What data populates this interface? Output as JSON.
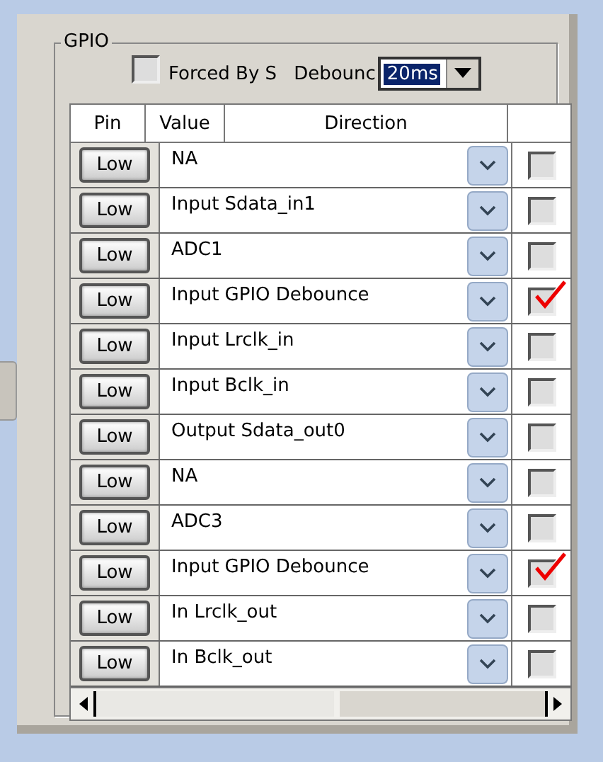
{
  "group": {
    "title": "GPIO"
  },
  "forced": {
    "label": "Forced By S",
    "checked": false
  },
  "debounce": {
    "label": "Debounc",
    "value": "20ms"
  },
  "table": {
    "columns": [
      "Pin",
      "Value",
      "Direction"
    ],
    "rows": [
      {
        "pin": "Low",
        "direction": "NA",
        "checked": false
      },
      {
        "pin": "Low",
        "direction": "Input  Sdata_in1",
        "checked": false
      },
      {
        "pin": "Low",
        "direction": "ADC1",
        "checked": false
      },
      {
        "pin": "Low",
        "direction": "Input  GPIO Debounce",
        "checked": true
      },
      {
        "pin": "Low",
        "direction": "Input  Lrclk_in",
        "checked": false
      },
      {
        "pin": "Low",
        "direction": "Input  Bclk_in",
        "checked": false
      },
      {
        "pin": "Low",
        "direction": "Output Sdata_out0",
        "checked": false
      },
      {
        "pin": "Low",
        "direction": "NA",
        "checked": false
      },
      {
        "pin": "Low",
        "direction": "ADC3",
        "checked": false
      },
      {
        "pin": "Low",
        "direction": "Input  GPIO Debounce",
        "checked": true
      },
      {
        "pin": "Low",
        "direction": "In Lrclk_out",
        "checked": false
      },
      {
        "pin": "Low",
        "direction": "In Bclk_out",
        "checked": false
      }
    ]
  }
}
